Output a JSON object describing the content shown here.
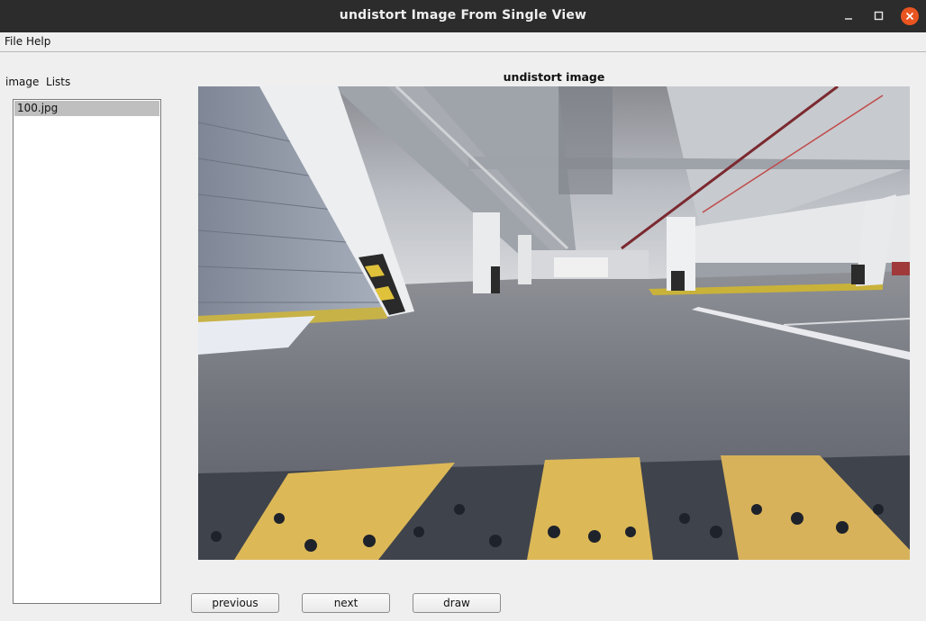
{
  "window": {
    "title": "undistort Image From Single View",
    "minimize_icon": "minimize-icon",
    "maximize_icon": "maximize-icon",
    "close_icon": "close-icon"
  },
  "menubar": {
    "items": [
      "File",
      "Help"
    ]
  },
  "sidebar": {
    "label": "image  Lists",
    "items": [
      "100.jpg"
    ],
    "selected": "100.jpg"
  },
  "main": {
    "image_title": "undistort image"
  },
  "buttons": {
    "previous": "previous",
    "next": "next",
    "draw": "draw"
  },
  "colors": {
    "titlebar": "#2c2c2c",
    "close_button": "#e95420",
    "selection": "#bfbfbf",
    "background": "#efefef"
  }
}
